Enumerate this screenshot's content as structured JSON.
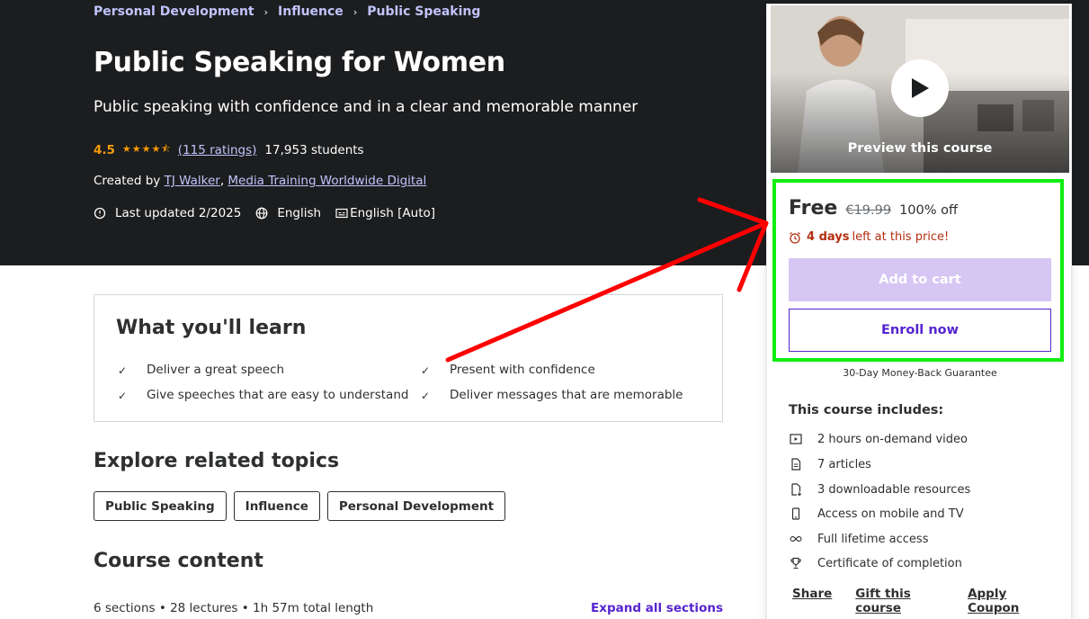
{
  "breadcrumb": {
    "item1": "Personal Development",
    "item2": "Influence",
    "item3": "Public Speaking"
  },
  "course": {
    "title": "Public Speaking for Women",
    "subtitle": "Public speaking with confidence and in a clear and memorable manner",
    "rating": "4.5",
    "stars": "★★★★⯪",
    "ratings_count": "(115 ratings)",
    "students": "17,953 students",
    "created_by_label": "Created by",
    "author1": "TJ Walker",
    "author_sep": ",",
    "author2": "Media Training Worldwide Digital",
    "last_updated": "Last updated 2/2025",
    "language": "English",
    "captions": "English [Auto]"
  },
  "learn": {
    "title": "What you'll learn",
    "items": [
      "Deliver a great speech",
      "Present with confidence",
      "Give speeches that are easy to understand",
      "Deliver messages that are memorable"
    ]
  },
  "topics": {
    "title": "Explore related topics",
    "items": [
      "Public Speaking",
      "Influence",
      "Personal Development"
    ]
  },
  "content": {
    "title": "Course content",
    "meta": "6 sections • 28 lectures • 1h 57m total length",
    "expand": "Expand all sections"
  },
  "sidebar": {
    "preview_label": "Preview this course",
    "price": "Free",
    "original_price": "€19.99",
    "discount": "100% off",
    "timer_days": "4 days",
    "timer_text": "left at this price!",
    "add_to_cart": "Add to cart",
    "enroll": "Enroll now",
    "guarantee": "30-Day Money-Back Guarantee",
    "includes_title": "This course includes:",
    "includes": [
      "2 hours on-demand video",
      "7 articles",
      "3 downloadable resources",
      "Access on mobile and TV",
      "Full lifetime access",
      "Certificate of completion"
    ],
    "links": [
      "Share",
      "Gift this course",
      "Apply Coupon"
    ]
  },
  "colors": {
    "hero_bg": "#1c1d1f",
    "link_purple": "#c0c4fc",
    "star_orange": "#f69c08",
    "brand_purple": "#5624d0",
    "cart_disabled": "#d5c6f4",
    "timer_red": "#b32d0f",
    "annotation_green": "#11ee11",
    "annotation_red": "#ff0000"
  }
}
